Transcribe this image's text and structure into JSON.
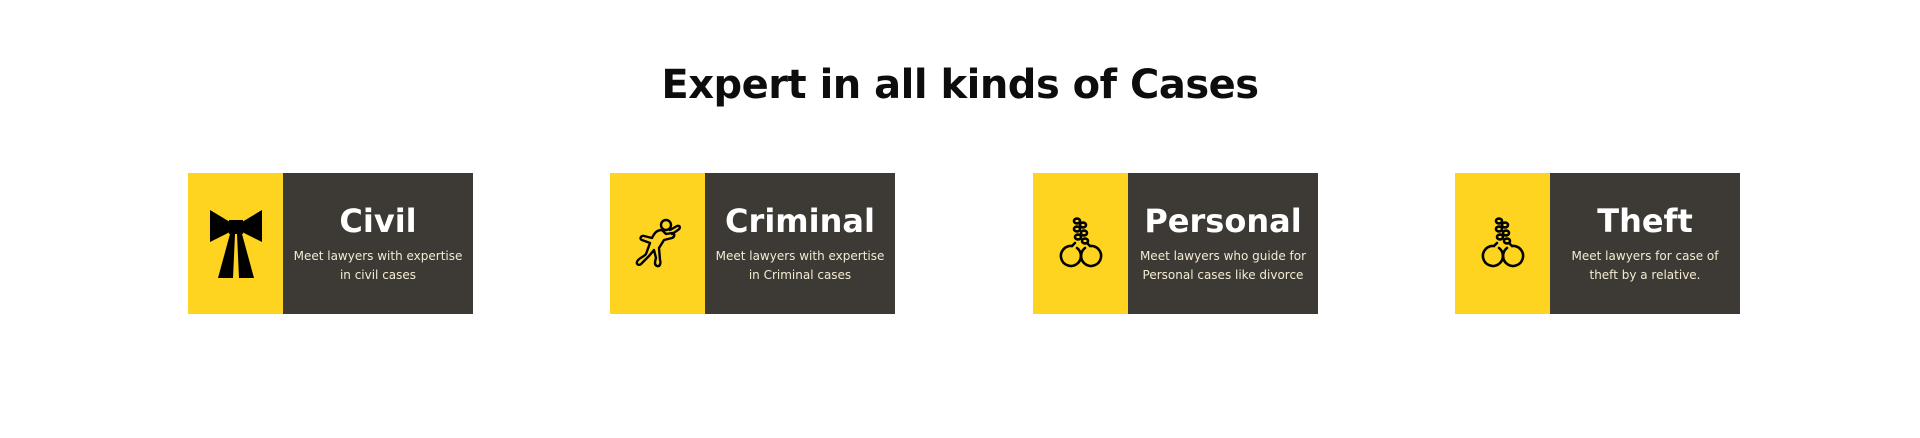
{
  "section": {
    "title": "Expert in all kinds of Cases"
  },
  "colors": {
    "accent_yellow": "#fed420",
    "card_dark": "#3d3935",
    "title_text": "#0d0d0d",
    "card_title_text": "#ffffff",
    "card_desc_text": "#f3ecd3"
  },
  "cards": [
    {
      "icon": "lawyer-band-icon",
      "title": "Civil",
      "description": "Meet lawyers with expertise in civil cases"
    },
    {
      "icon": "crime-scene-body-icon",
      "title": "Criminal",
      "description": "Meet lawyers with expertise in Criminal cases"
    },
    {
      "icon": "handcuffs-icon",
      "title": "Personal",
      "description": "Meet lawyers who guide for Personal cases like divorce"
    },
    {
      "icon": "handcuffs-icon",
      "title": "Theft",
      "description": "Meet lawyers for case of theft by a relative."
    }
  ]
}
